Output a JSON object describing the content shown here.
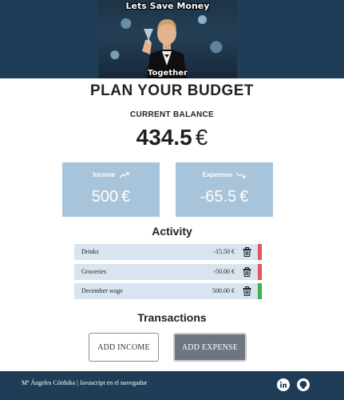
{
  "hero": {
    "caption_top": "Lets Save Money",
    "caption_bottom": "Together"
  },
  "page_title": "PLAN YOUR BUDGET",
  "balance": {
    "label": "CURRENT BALANCE",
    "value": "434.5",
    "unit": "€"
  },
  "cards": {
    "income": {
      "label": "Income",
      "amount": "500",
      "unit": "€",
      "icon": "trend-up-icon"
    },
    "expenses": {
      "label": "Expenses",
      "amount": "-65.5",
      "unit": "€",
      "icon": "trend-down-icon"
    }
  },
  "activity": {
    "title": "Activity",
    "items": [
      {
        "name": "Drinks",
        "amount": "-15.50 €",
        "type": "expense"
      },
      {
        "name": "Groceries",
        "amount": "-50.00 €",
        "type": "expense"
      },
      {
        "name": "December wage",
        "amount": "500.00 €",
        "type": "income"
      }
    ]
  },
  "transactions": {
    "title": "Transactions",
    "add_income_label": "ADD INCOME",
    "add_expense_label": "ADD EXPENSE"
  },
  "footer": {
    "credit": "Mª Ángeles Córdoba | Javascript en el navegador",
    "icons": [
      "linkedin-icon",
      "github-icon"
    ]
  },
  "colors": {
    "header_bg": "#1f3d57",
    "card_bg": "#a8c4da",
    "row_bg": "#d8e4ef",
    "expense_marker": "#e0555a",
    "income_marker": "#3fb04a",
    "expense_button": "#6f7681"
  }
}
